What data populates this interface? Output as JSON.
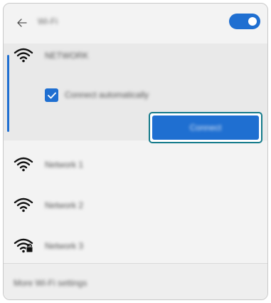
{
  "header": {
    "back_icon": "back-arrow-icon",
    "title": "Wi-Fi",
    "toggle_state": "on"
  },
  "colors": {
    "accent": "#1f6fd1",
    "focus_ring": "#147a8a",
    "panel_bg": "#f3f3f3",
    "expanded_bg": "#e9e9e9"
  },
  "selected_network": {
    "icon": "wifi-full-icon",
    "name": "NETWORK",
    "auto_connect_checked": true,
    "auto_connect_label": "Connect automatically",
    "connect_label": "Connect"
  },
  "networks": [
    {
      "icon": "wifi-full-icon",
      "name": "Network 1",
      "secured": false
    },
    {
      "icon": "wifi-full-icon",
      "name": "Network 2",
      "secured": false
    },
    {
      "icon": "wifi-secured-icon",
      "name": "Network 3",
      "secured": true
    }
  ],
  "footer": {
    "link_label": "More Wi-Fi settings"
  }
}
